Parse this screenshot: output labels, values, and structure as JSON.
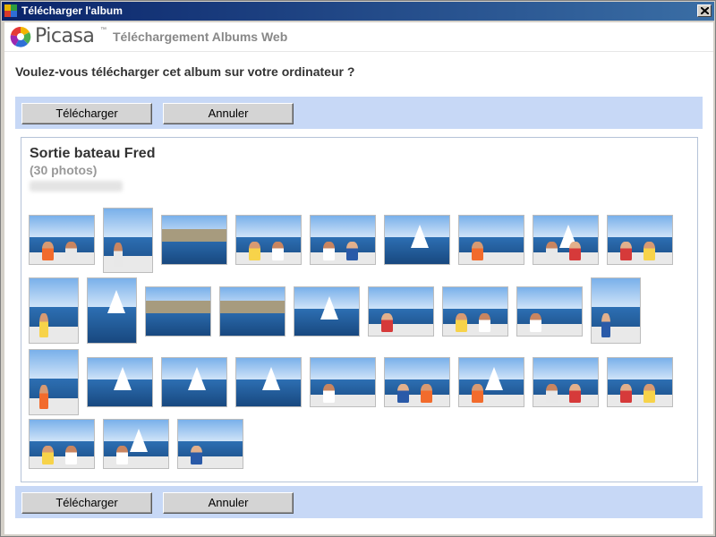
{
  "window": {
    "title": "Télécharger l'album",
    "close_icon": "close-icon"
  },
  "header": {
    "logo_text": "Picasa",
    "logo_tm": "™",
    "title": "Téléchargement Albums Web"
  },
  "question": "Voulez-vous télécharger cet album sur votre ordinateur ?",
  "buttons": {
    "download": "Télécharger",
    "cancel": "Annuler"
  },
  "album": {
    "title": "Sortie bateau Fred",
    "count": "(30 photos)"
  },
  "photos": [
    "crew-on-deck",
    "woman-at-wheel",
    "fortress-on-coast",
    "people-smiling",
    "couple-with-hats",
    "sail-and-sea",
    "man-at-helm",
    "sailboat-crew",
    "group-on-deck",
    "man-with-hat",
    "mast-closeup",
    "fort-island",
    "fort-on-sea",
    "mast-and-sky",
    "man-pointing",
    "couple-on-boat",
    "woman-on-deck",
    "man-standing",
    "woman-in-orange",
    "regatta-sail-1",
    "regatta-sail-2",
    "regatta-sail-3",
    "man-in-cap",
    "couple-in-hats",
    "man-and-sail",
    "people-on-bow",
    "group-on-bow",
    "crew-on-stern",
    "man-by-mast",
    "girl-smiling"
  ]
}
